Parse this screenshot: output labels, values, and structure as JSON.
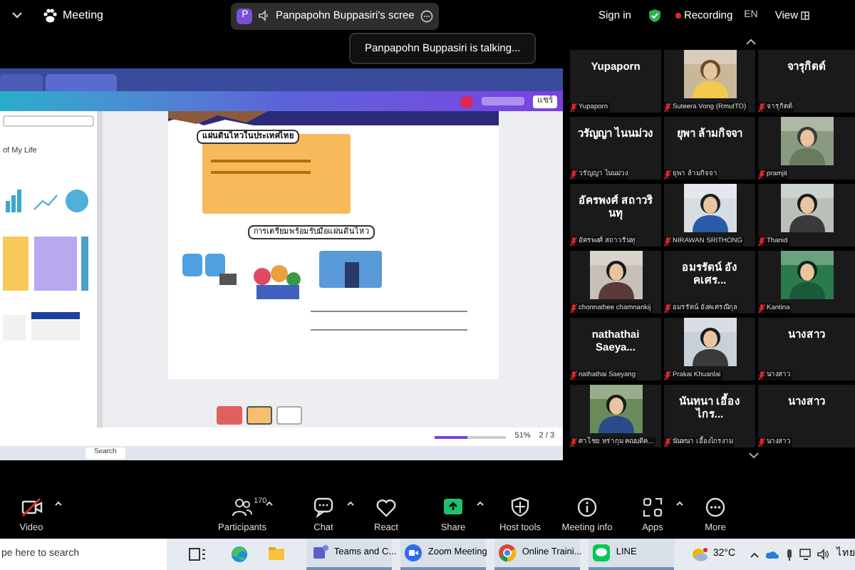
{
  "top_bar": {
    "title": "Meeting",
    "share_pill": {
      "avatar": "P",
      "label": "Panpapohn Buppasiri's scree"
    },
    "sign_in": "Sign in",
    "recording": "Recording",
    "language": "EN",
    "view": "View"
  },
  "talking_toast": "Panpapohn Buppasiri is talking...",
  "shared_screen": {
    "panel_item": "of My Life",
    "share_button": "แชร์",
    "slide_heading": "แผ่นดินไหวในประเทศไทย",
    "slide_subheading": "การเตรียมพร้อมรับมือแผ่นดินไหว",
    "zoom_slider": {
      "level": 0.45
    },
    "zoom_level": "51%",
    "page_counter": "2 / 3",
    "search": "Search"
  },
  "participants": [
    {
      "kind": "name",
      "display_name": "Yupaporn",
      "label": "Yupaporn",
      "muted": true
    },
    {
      "kind": "video",
      "label": "Suteera Vong (RmutTO)",
      "muted": true
    },
    {
      "kind": "name",
      "display_name": "จารุกิตต์",
      "label": "จารุกิตต์",
      "muted": true
    },
    {
      "kind": "name",
      "display_name": "วรัญญา ไนนม่วง",
      "label": "วรัญญา ไนนม่วง",
      "muted": true
    },
    {
      "kind": "name",
      "display_name": "ยุพา ล้ามกิจจา",
      "label": "ยุพา ล้ามกิจจา",
      "muted": true
    },
    {
      "kind": "video",
      "label": "pramjit",
      "muted": true
    },
    {
      "kind": "name",
      "display_name": "อัครพงศ์ สถาวรินทุ",
      "label": "อัครพงศ์ สถาวรินทุ",
      "muted": true
    },
    {
      "kind": "video",
      "label": "NIRAWAN SRITHONG",
      "muted": true
    },
    {
      "kind": "video",
      "label": "Thanid",
      "muted": true
    },
    {
      "kind": "video",
      "label": "chonnathee chamnankij",
      "muted": true
    },
    {
      "kind": "name",
      "display_name": "อมรรัตน์ อังคเศร...",
      "label": "อมรรัตน์ อังคเศรณีกุล",
      "muted": true
    },
    {
      "kind": "video",
      "label": "Kantina",
      "muted": true
    },
    {
      "kind": "name",
      "display_name": "nathathai Saeya...",
      "label": "nathathai Saeyang",
      "muted": true
    },
    {
      "kind": "video",
      "label": "Prakai Khuanlai",
      "muted": true
    },
    {
      "kind": "name",
      "display_name": "นางสาว",
      "label": "นางสาว",
      "muted": true
    },
    {
      "kind": "video",
      "label": "ศาโชย หร่ากุม คณบดีค...",
      "muted": true
    },
    {
      "kind": "name",
      "display_name": "นันทนา เอื้องไกร...",
      "label": "นันทนา เอื้องไกรงาม",
      "muted": true
    },
    {
      "kind": "name",
      "display_name": "นางสาว",
      "label": "นางสาว",
      "muted": true
    }
  ],
  "toolbar": [
    {
      "kind": "video",
      "label": "Video",
      "off": true,
      "has_menu": true
    },
    {
      "kind": "participants",
      "label": "Participants",
      "count": "170",
      "has_menu": true
    },
    {
      "kind": "chat",
      "label": "Chat",
      "has_menu": true
    },
    {
      "kind": "react",
      "label": "React",
      "has_menu": false
    },
    {
      "kind": "share",
      "label": "Share",
      "has_menu": true
    },
    {
      "kind": "host",
      "label": "Host tools",
      "has_menu": false
    },
    {
      "kind": "info",
      "label": "Meeting info",
      "has_menu": false
    },
    {
      "kind": "apps",
      "label": "Apps",
      "has_menu": true
    },
    {
      "kind": "more",
      "label": "More",
      "has_menu": false
    }
  ],
  "taskbar": {
    "search_placeholder": "pe here to search",
    "apps": [
      {
        "kind": "task-view"
      },
      {
        "kind": "edge"
      },
      {
        "kind": "files"
      },
      {
        "kind": "teams",
        "label": "Teams and C..."
      },
      {
        "kind": "zoom",
        "label": "Zoom Meeting"
      },
      {
        "kind": "chrome",
        "label": "Online Traini..."
      },
      {
        "kind": "line",
        "label": "LINE"
      }
    ],
    "weather": "32°C",
    "language": "ไทย"
  }
}
